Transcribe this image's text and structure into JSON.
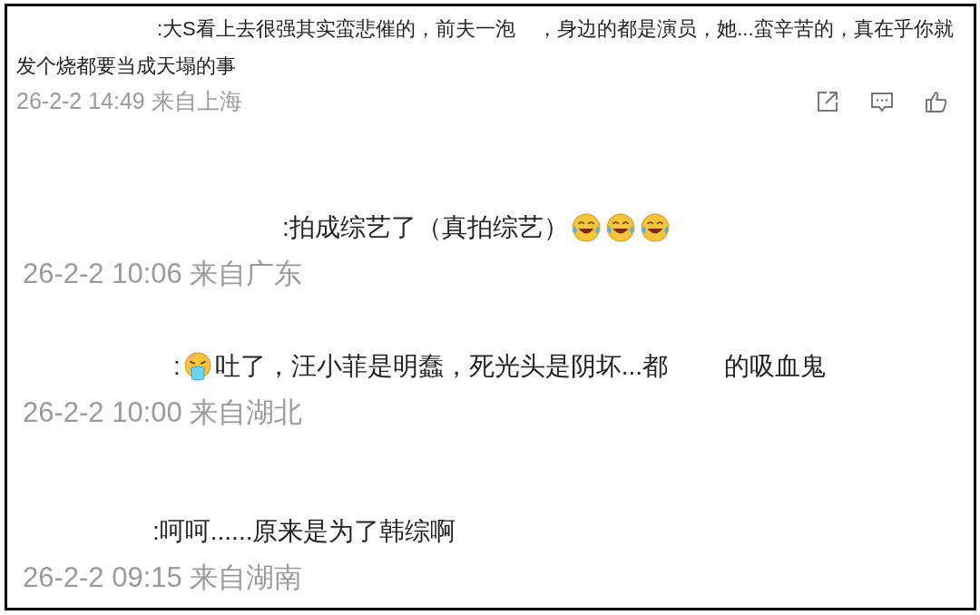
{
  "comments": [
    {
      "parts": [
        {
          "kind": "text",
          "text": ":大S看上去很强其实蛮悲催的，前夫一泡    ，身边的都是演员，她...蛮辛苦的，真在乎你就发个烧都要当成天塌的事"
        }
      ],
      "time": "26-2-2 14:49 来自上海",
      "actions_shown": true
    },
    {
      "parts": [
        {
          "kind": "text",
          "text": ":拍成综艺了（真拍综艺）"
        },
        {
          "kind": "laugh"
        },
        {
          "kind": "laugh"
        },
        {
          "kind": "laugh"
        }
      ],
      "time": "26-2-2 10:06 来自广东",
      "actions_shown": false
    },
    {
      "parts": [
        {
          "kind": "text",
          "text": ":"
        },
        {
          "kind": "vomit"
        },
        {
          "kind": "text",
          "text": "吐了，汪小菲是明蠢，死光头是阴坏...都        的吸血鬼"
        }
      ],
      "time": "26-2-2 10:00 来自湖北",
      "actions_shown": false
    },
    {
      "parts": [
        {
          "kind": "text",
          "text": ":呵呵......原来是为了韩综啊"
        }
      ],
      "time": "26-2-2 09:15 来自湖南",
      "actions_shown": false
    }
  ]
}
